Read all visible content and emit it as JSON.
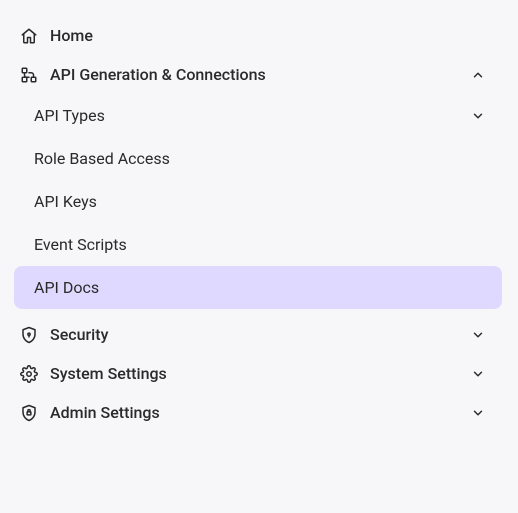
{
  "nav": {
    "home": {
      "label": "Home"
    },
    "api_gen": {
      "label": "API Generation & Connections",
      "expanded": true,
      "items": [
        {
          "label": "API Types",
          "has_submenu": true
        },
        {
          "label": "Role Based Access"
        },
        {
          "label": "API Keys"
        },
        {
          "label": "Event Scripts"
        },
        {
          "label": "API Docs",
          "active": true
        }
      ]
    },
    "security": {
      "label": "Security"
    },
    "system_settings": {
      "label": "System Settings"
    },
    "admin_settings": {
      "label": "Admin Settings"
    }
  }
}
